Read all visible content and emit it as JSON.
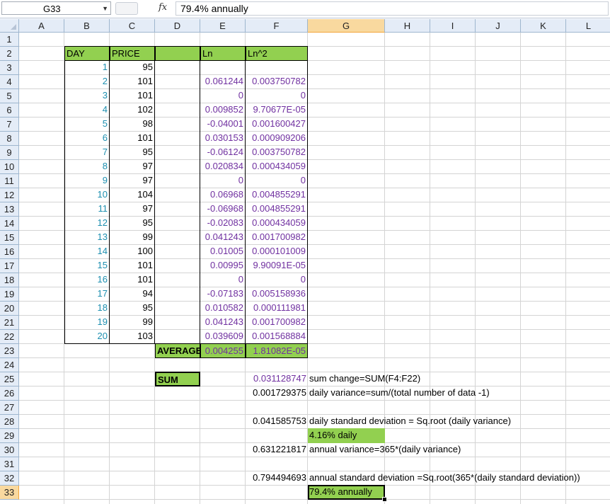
{
  "name_box": "G33",
  "formula": "79.4% annually",
  "columns": [
    "A",
    "B",
    "C",
    "D",
    "E",
    "F",
    "G",
    "H",
    "I",
    "J",
    "K",
    "L"
  ],
  "selected_column": "G",
  "selected_row": 33,
  "headers": {
    "day": "DAY",
    "price": "PRICE",
    "ln": "Ln",
    "ln2": "Ln^2"
  },
  "rows": [
    {
      "day": "1",
      "price": "95",
      "ln": "",
      "ln2": ""
    },
    {
      "day": "2",
      "price": "101",
      "ln": "0.061244",
      "ln2": "0.003750782"
    },
    {
      "day": "3",
      "price": "101",
      "ln": "0",
      "ln2": "0"
    },
    {
      "day": "4",
      "price": "102",
      "ln": "0.009852",
      "ln2": "9.70677E-05"
    },
    {
      "day": "5",
      "price": "98",
      "ln": "-0.04001",
      "ln2": "0.001600427"
    },
    {
      "day": "6",
      "price": "101",
      "ln": "0.030153",
      "ln2": "0.000909206"
    },
    {
      "day": "7",
      "price": "95",
      "ln": "-0.06124",
      "ln2": "0.003750782"
    },
    {
      "day": "8",
      "price": "97",
      "ln": "0.020834",
      "ln2": "0.000434059"
    },
    {
      "day": "9",
      "price": "97",
      "ln": "0",
      "ln2": "0"
    },
    {
      "day": "10",
      "price": "104",
      "ln": "0.06968",
      "ln2": "0.004855291"
    },
    {
      "day": "11",
      "price": "97",
      "ln": "-0.06968",
      "ln2": "0.004855291"
    },
    {
      "day": "12",
      "price": "95",
      "ln": "-0.02083",
      "ln2": "0.000434059"
    },
    {
      "day": "13",
      "price": "99",
      "ln": "0.041243",
      "ln2": "0.001700982"
    },
    {
      "day": "14",
      "price": "100",
      "ln": "0.01005",
      "ln2": "0.000101009"
    },
    {
      "day": "15",
      "price": "101",
      "ln": "0.00995",
      "ln2": "9.90091E-05"
    },
    {
      "day": "16",
      "price": "101",
      "ln": "0",
      "ln2": "0"
    },
    {
      "day": "17",
      "price": "94",
      "ln": "-0.07183",
      "ln2": "0.005158936"
    },
    {
      "day": "18",
      "price": "95",
      "ln": "0.010582",
      "ln2": "0.000111981"
    },
    {
      "day": "19",
      "price": "99",
      "ln": "0.041243",
      "ln2": "0.001700982"
    },
    {
      "day": "20",
      "price": "103",
      "ln": "0.039609",
      "ln2": "0.001568884"
    }
  ],
  "average": {
    "label": "AVERAGE",
    "ln": "0.004255",
    "ln2": "1.81082E-05"
  },
  "sum_label": "SUM",
  "stats": [
    {
      "row": 25,
      "value": "0.031128747",
      "note": "sum change=SUM(F4:F22)"
    },
    {
      "row": 26,
      "value": "0.001729375",
      "note": "daily variance=sum/(total number of data -1)"
    },
    {
      "row": 28,
      "value": "0.041585753",
      "note": "daily standard deviation = Sq.root (daily variance)"
    },
    {
      "row": 30,
      "value": "0.631221817",
      "note": "annual variance=365*(daily variance)"
    },
    {
      "row": 32,
      "value": "0.794494693",
      "note": "annual standard deviation =Sq.root(365*(daily standard deviation))"
    }
  ],
  "daily_result": "4.16% daily",
  "annual_result": "79.4% annually"
}
